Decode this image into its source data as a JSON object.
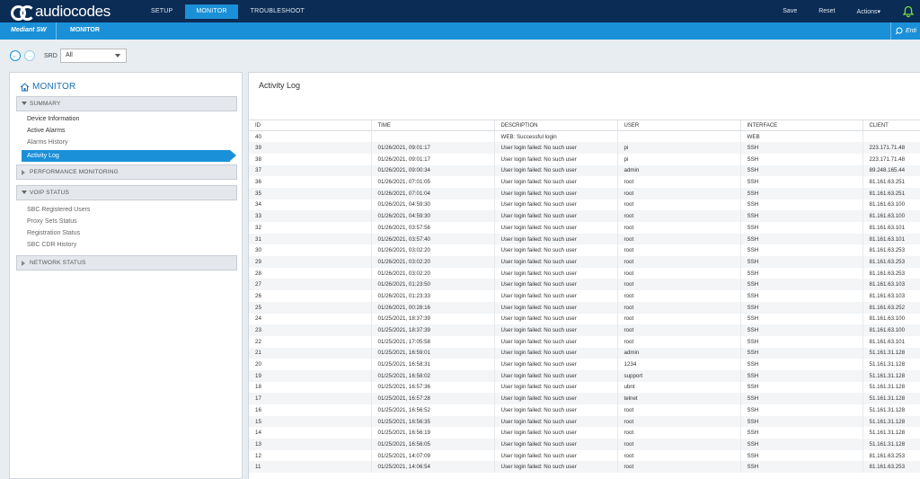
{
  "brand": {
    "logo_text": "audiocodes"
  },
  "topnav": {
    "items": [
      {
        "label": "SETUP"
      },
      {
        "label": "MONITOR"
      },
      {
        "label": "TROUBLESHOOT"
      }
    ],
    "active": "MONITOR"
  },
  "topright": {
    "save": "Save",
    "reset": "Reset",
    "actions": "Actions▾"
  },
  "subbar": {
    "device": "Mediant SW",
    "crumb": "MONITOR",
    "filter": "Enti"
  },
  "toolbar": {
    "srd_label": "SRD",
    "srd_value": "All"
  },
  "sidebar": {
    "title": "MONITOR",
    "summary": "SUMMARY",
    "summary_items": [
      "Device Information",
      "Active Alarms",
      "Alarms History",
      "Activity Log"
    ],
    "performance": "PERFORMANCE MONITORING",
    "voip": "VOIP STATUS",
    "voip_items": [
      "SBC Registered Users",
      "Proxy Sets Status",
      "Registration Status",
      "SBC CDR History"
    ],
    "network": "NETWORK STATUS"
  },
  "page": {
    "title": "Activity Log"
  },
  "table": {
    "columns": [
      "ID",
      "TIME",
      "DESCRIPTION",
      "USER",
      "INTERFACE",
      "CLIENT"
    ],
    "rows": [
      [
        "40",
        "",
        "WEB: Successful login",
        "",
        "WEB",
        ""
      ],
      [
        "39",
        "01/26/2021, 09:01:17",
        "User login failed: No such user",
        "pi",
        "SSH",
        "223.171.71.48"
      ],
      [
        "38",
        "01/26/2021, 09:01:17",
        "User login failed: No such user",
        "pi",
        "SSH",
        "223.171.71.48"
      ],
      [
        "37",
        "01/26/2021, 09:00:34",
        "User login failed: No such user",
        "admin",
        "SSH",
        "89.248.165.44"
      ],
      [
        "36",
        "01/26/2021, 07:01:05",
        "User login failed: No such user",
        "root",
        "SSH",
        "81.161.63.251"
      ],
      [
        "35",
        "01/26/2021, 07:01:04",
        "User login failed: No such user",
        "root",
        "SSH",
        "81.161.63.251"
      ],
      [
        "34",
        "01/26/2021, 04:59:30",
        "User login failed: No such user",
        "root",
        "SSH",
        "81.161.63.100"
      ],
      [
        "33",
        "01/26/2021, 04:59:30",
        "User login failed: No such user",
        "root",
        "SSH",
        "81.161.63.100"
      ],
      [
        "32",
        "01/26/2021, 03:57:56",
        "User login failed: No such user",
        "root",
        "SSH",
        "81.161.63.101"
      ],
      [
        "31",
        "01/26/2021, 03:57:40",
        "User login failed: No such user",
        "root",
        "SSH",
        "81.161.63.101"
      ],
      [
        "30",
        "01/26/2021, 03:02:20",
        "User login failed: No such user",
        "root",
        "SSH",
        "81.161.63.253"
      ],
      [
        "29",
        "01/26/2021, 03:02:20",
        "User login failed: No such user",
        "root",
        "SSH",
        "81.161.63.253"
      ],
      [
        "28",
        "01/26/2021, 03:02:20",
        "User login failed: No such user",
        "root",
        "SSH",
        "81.161.63.253"
      ],
      [
        "27",
        "01/26/2021, 01:23:50",
        "User login failed: No such user",
        "root",
        "SSH",
        "81.161.63.103"
      ],
      [
        "26",
        "01/26/2021, 01:23:33",
        "User login failed: No such user",
        "root",
        "SSH",
        "81.161.63.103"
      ],
      [
        "25",
        "01/26/2021, 00:28:16",
        "User login failed: No such user",
        "root",
        "SSH",
        "81.161.63.252"
      ],
      [
        "24",
        "01/25/2021, 18:37:39",
        "User login failed: No such user",
        "root",
        "SSH",
        "81.161.63.100"
      ],
      [
        "23",
        "01/25/2021, 18:37:39",
        "User login failed: No such user",
        "root",
        "SSH",
        "81.161.63.100"
      ],
      [
        "22",
        "01/25/2021, 17:05:58",
        "User login failed: No such user",
        "root",
        "SSH",
        "81.161.63.101"
      ],
      [
        "21",
        "01/25/2021, 16:59:01",
        "User login failed: No such user",
        "admin",
        "SSH",
        "51.161.31.128"
      ],
      [
        "20",
        "01/25/2021, 16:58:31",
        "User login failed: No such user",
        "1234",
        "SSH",
        "51.161.31.128"
      ],
      [
        "19",
        "01/25/2021, 16:58:02",
        "User login failed: No such user",
        "support",
        "SSH",
        "51.161.31.128"
      ],
      [
        "18",
        "01/25/2021, 16:57:36",
        "User login failed: No such user",
        "ubnt",
        "SSH",
        "51.161.31.128"
      ],
      [
        "17",
        "01/25/2021, 16:57:28",
        "User login failed: No such user",
        "telnet",
        "SSH",
        "51.161.31.128"
      ],
      [
        "16",
        "01/25/2021, 16:56:52",
        "User login failed: No such user",
        "root",
        "SSH",
        "51.161.31.128"
      ],
      [
        "15",
        "01/25/2021, 16:56:35",
        "User login failed: No such user",
        "root",
        "SSH",
        "51.161.31.128"
      ],
      [
        "14",
        "01/25/2021, 16:56:19",
        "User login failed: No such user",
        "root",
        "SSH",
        "51.161.31.128"
      ],
      [
        "13",
        "01/25/2021, 16:56:05",
        "User login failed: No such user",
        "root",
        "SSH",
        "51.161.31.128"
      ],
      [
        "12",
        "01/25/2021, 14:07:09",
        "User login failed: No such user",
        "root",
        "SSH",
        "81.161.63.253"
      ],
      [
        "11",
        "01/25/2021, 14:06:54",
        "User login failed: No such user",
        "root",
        "SSH",
        "81.161.63.253"
      ]
    ]
  },
  "colors": {
    "navy": "#0b2c54",
    "accent": "#1a90d8"
  }
}
